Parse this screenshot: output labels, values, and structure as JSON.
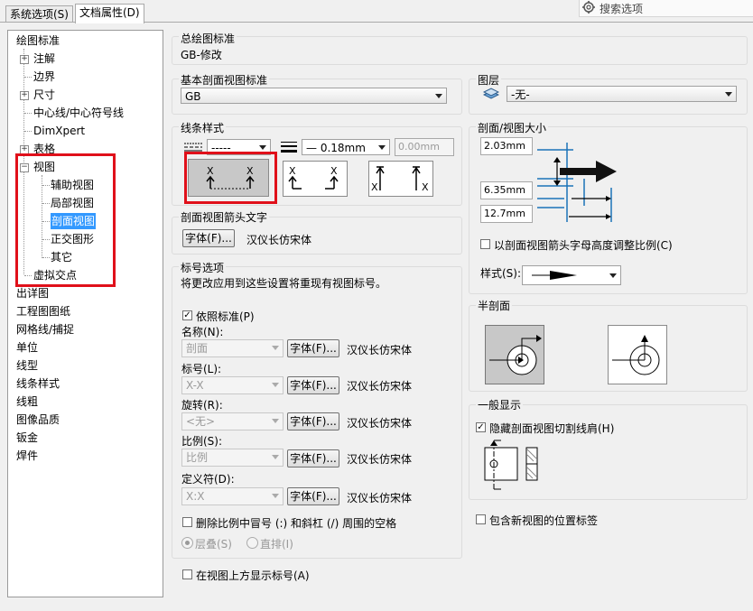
{
  "tabs": {
    "system": "系统选项(S)",
    "document": "文档属性(D)"
  },
  "search": {
    "label": "搜索选项"
  },
  "tree": {
    "root": "绘图标准",
    "items": [
      "注解",
      "边界",
      "尺寸",
      "中心线/中心符号线",
      "DimXpert",
      "表格",
      "视图"
    ],
    "view_children": [
      "辅助视图",
      "局部视图",
      "剖面视图",
      "正交图形",
      "其它"
    ],
    "virtual": "虚拟交点",
    "bottom": [
      "出详图",
      "工程图图纸",
      "网格线/捕捉",
      "单位",
      "线型",
      "线条样式",
      "线粗",
      "图像品质",
      "钣金",
      "焊件"
    ]
  },
  "overall": {
    "label": "总绘图标准",
    "value": "GB-修改"
  },
  "base": {
    "label": "基本剖面视图标准",
    "value": "GB"
  },
  "layer": {
    "label": "图层",
    "value": "-无-"
  },
  "linestyle": {
    "label": "线条样式",
    "style_value": "-----",
    "weight_value": "— 0.18mm",
    "custom_value": "0.00mm"
  },
  "arrowtext": {
    "label": "剖面视图箭头文字",
    "font_button": "字体(F)...",
    "font_name": "汉仪长仿宋体"
  },
  "size": {
    "label": "剖面/视图大小",
    "v1": "2.03mm",
    "v2": "6.35mm",
    "v3": "12.7mm",
    "scale_check": "以剖面视图箭头字母高度调整比例(C)",
    "style_label": "样式(S):"
  },
  "label_opts": {
    "label": "标号选项",
    "note": "将更改应用到这些设置将重现有视图标号。",
    "per_standard": "依照标准(P)",
    "rows": [
      {
        "label": "名称(N):",
        "value": "剖面",
        "font": "字体(F)...",
        "font_name": "汉仪长仿宋体"
      },
      {
        "label": "标号(L):",
        "value": "X-X",
        "font": "字体(F)...",
        "font_name": "汉仪长仿宋体"
      },
      {
        "label": "旋转(R):",
        "value": "<无>",
        "font": "字体(F)...",
        "font_name": "汉仪长仿宋体"
      },
      {
        "label": "比例(S):",
        "value": "比例",
        "font": "字体(F)...",
        "font_name": "汉仪长仿宋体"
      },
      {
        "label": "定义符(D):",
        "value": "X:X",
        "font": "字体(F)...",
        "font_name": "汉仪长仿宋体"
      }
    ],
    "delete_spaces": "删除比例中冒号 (:) 和斜杠 (/) 周围的空格",
    "stacked": "层叠(S)",
    "straight": "直排(I)"
  },
  "show_above": "在视图上方显示标号(A)",
  "half": {
    "label": "半剖面"
  },
  "general": {
    "label": "一般显示",
    "hide_shoulder": "隐藏剖面视图切割线肩(H)"
  },
  "include_pos": "包含新视图的位置标签",
  "colors": {
    "selected": "#3399ff",
    "highlight": "#e0101a"
  }
}
